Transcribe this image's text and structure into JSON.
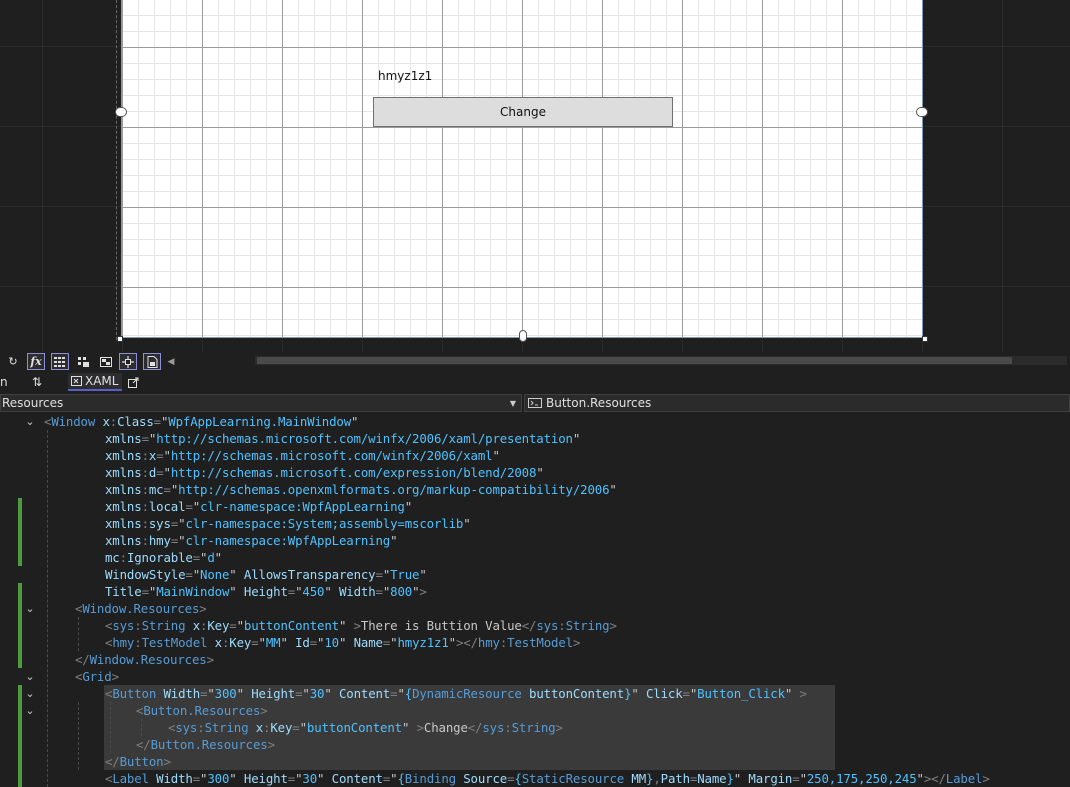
{
  "designer": {
    "label_text": "hmyz1z1",
    "button_text": "Change"
  },
  "toolbar": {
    "refresh_icon": "refresh-icon",
    "formula_icon": "fx-icon",
    "fx_label": "fx",
    "grid_icon": "grid-icon",
    "snap_icon": "snap-to-grid-icon",
    "artboard_icon": "artboard-icon",
    "snaplines_icon": "snaplines-icon",
    "project_code_icon": "project-code-icon",
    "scroll_left_icon": "scroll-left-icon"
  },
  "split_tabs": {
    "design_stub": "n",
    "swap_icon": "swap-panes-icon",
    "xaml_tab": "XAML",
    "popout_icon": "popout-icon"
  },
  "nav": {
    "left_combo": "Resources",
    "right_combo": "Button.Resources"
  },
  "code_lines": [
    [
      [
        "p",
        "<"
      ],
      [
        "e",
        "Window"
      ],
      [
        "a",
        " x"
      ],
      [
        "p",
        ":"
      ],
      [
        "a",
        "Class"
      ],
      [
        "p",
        "="
      ],
      [
        "x",
        "\""
      ],
      [
        "v",
        "WpfAppLearning.MainWindow"
      ],
      [
        "x",
        "\""
      ]
    ],
    [
      [
        "a",
        "xmlns"
      ],
      [
        "p",
        "="
      ],
      [
        "x",
        "\""
      ],
      [
        "v",
        "http://schemas.microsoft.com/winfx/2006/xaml/presentation"
      ],
      [
        "x",
        "\""
      ]
    ],
    [
      [
        "a",
        "xmlns"
      ],
      [
        "p",
        ":"
      ],
      [
        "a",
        "x"
      ],
      [
        "p",
        "="
      ],
      [
        "x",
        "\""
      ],
      [
        "v",
        "http://schemas.microsoft.com/winfx/2006/xaml"
      ],
      [
        "x",
        "\""
      ]
    ],
    [
      [
        "a",
        "xmlns"
      ],
      [
        "p",
        ":"
      ],
      [
        "a",
        "d"
      ],
      [
        "p",
        "="
      ],
      [
        "x",
        "\""
      ],
      [
        "v",
        "http://schemas.microsoft.com/expression/blend/2008"
      ],
      [
        "x",
        "\""
      ]
    ],
    [
      [
        "a",
        "xmlns"
      ],
      [
        "p",
        ":"
      ],
      [
        "a",
        "mc"
      ],
      [
        "p",
        "="
      ],
      [
        "x",
        "\""
      ],
      [
        "v",
        "http://schemas.openxmlformats.org/markup-compatibility/2006"
      ],
      [
        "x",
        "\""
      ]
    ],
    [
      [
        "a",
        "xmlns"
      ],
      [
        "p",
        ":"
      ],
      [
        "a",
        "local"
      ],
      [
        "p",
        "="
      ],
      [
        "x",
        "\""
      ],
      [
        "v",
        "clr-namespace:WpfAppLearning"
      ],
      [
        "x",
        "\""
      ]
    ],
    [
      [
        "a",
        "xmlns"
      ],
      [
        "p",
        ":"
      ],
      [
        "a",
        "sys"
      ],
      [
        "p",
        "="
      ],
      [
        "x",
        "\""
      ],
      [
        "v",
        "clr-namespace:System;assembly=mscorlib"
      ],
      [
        "x",
        "\""
      ]
    ],
    [
      [
        "a",
        "xmlns"
      ],
      [
        "p",
        ":"
      ],
      [
        "a",
        "hmy"
      ],
      [
        "p",
        "="
      ],
      [
        "x",
        "\""
      ],
      [
        "v",
        "clr-namespace:WpfAppLearning"
      ],
      [
        "x",
        "\""
      ]
    ],
    [
      [
        "a",
        "mc"
      ],
      [
        "p",
        ":"
      ],
      [
        "a",
        "Ignorable"
      ],
      [
        "p",
        "="
      ],
      [
        "x",
        "\""
      ],
      [
        "v",
        "d"
      ],
      [
        "x",
        "\""
      ]
    ],
    [
      [
        "a",
        "WindowStyle"
      ],
      [
        "p",
        "="
      ],
      [
        "x",
        "\""
      ],
      [
        "v",
        "None"
      ],
      [
        "x",
        "\""
      ],
      [
        "a",
        " AllowsTransparency"
      ],
      [
        "p",
        "="
      ],
      [
        "x",
        "\""
      ],
      [
        "v",
        "True"
      ],
      [
        "x",
        "\""
      ]
    ],
    [
      [
        "a",
        "Title"
      ],
      [
        "p",
        "="
      ],
      [
        "x",
        "\""
      ],
      [
        "v",
        "MainWindow"
      ],
      [
        "x",
        "\""
      ],
      [
        "a",
        " Height"
      ],
      [
        "p",
        "="
      ],
      [
        "x",
        "\""
      ],
      [
        "v",
        "450"
      ],
      [
        "x",
        "\""
      ],
      [
        "a",
        " Width"
      ],
      [
        "p",
        "="
      ],
      [
        "x",
        "\""
      ],
      [
        "v",
        "800"
      ],
      [
        "x",
        "\""
      ],
      [
        "p",
        ">"
      ]
    ],
    [
      [
        "p",
        "<"
      ],
      [
        "e",
        "Window.Resources"
      ],
      [
        "p",
        ">"
      ]
    ],
    [
      [
        "p",
        "<"
      ],
      [
        "e",
        "sys"
      ],
      [
        "p",
        ":"
      ],
      [
        "e",
        "String"
      ],
      [
        "a",
        " x"
      ],
      [
        "p",
        ":"
      ],
      [
        "a",
        "Key"
      ],
      [
        "p",
        "="
      ],
      [
        "x",
        "\""
      ],
      [
        "v",
        "buttonContent"
      ],
      [
        "x",
        "\""
      ],
      [
        "p",
        " >"
      ],
      [
        "x",
        "There is Buttion Value"
      ],
      [
        "p",
        "</"
      ],
      [
        "e",
        "sys"
      ],
      [
        "p",
        ":"
      ],
      [
        "e",
        "String"
      ],
      [
        "p",
        ">"
      ]
    ],
    [
      [
        "p",
        "<"
      ],
      [
        "e",
        "hmy"
      ],
      [
        "p",
        ":"
      ],
      [
        "e",
        "TestModel"
      ],
      [
        "a",
        " x"
      ],
      [
        "p",
        ":"
      ],
      [
        "a",
        "Key"
      ],
      [
        "p",
        "="
      ],
      [
        "x",
        "\""
      ],
      [
        "v",
        "MM"
      ],
      [
        "x",
        "\""
      ],
      [
        "a",
        " Id"
      ],
      [
        "p",
        "="
      ],
      [
        "x",
        "\""
      ],
      [
        "v",
        "10"
      ],
      [
        "x",
        "\""
      ],
      [
        "a",
        " Name"
      ],
      [
        "p",
        "="
      ],
      [
        "x",
        "\""
      ],
      [
        "v",
        "hmyz1z1"
      ],
      [
        "x",
        "\""
      ],
      [
        "p",
        "></"
      ],
      [
        "e",
        "hmy"
      ],
      [
        "p",
        ":"
      ],
      [
        "e",
        "TestModel"
      ],
      [
        "p",
        ">"
      ]
    ],
    [
      [
        "p",
        "</"
      ],
      [
        "e",
        "Window.Resources"
      ],
      [
        "p",
        ">"
      ]
    ],
    [
      [
        "p",
        "<"
      ],
      [
        "e",
        "Grid"
      ],
      [
        "p",
        ">"
      ]
    ],
    [
      [
        "p",
        "<"
      ],
      [
        "e",
        "Button"
      ],
      [
        "a",
        " Width"
      ],
      [
        "p",
        "="
      ],
      [
        "x",
        "\""
      ],
      [
        "v",
        "300"
      ],
      [
        "x",
        "\""
      ],
      [
        "a",
        " Height"
      ],
      [
        "p",
        "="
      ],
      [
        "x",
        "\""
      ],
      [
        "v",
        "30"
      ],
      [
        "x",
        "\""
      ],
      [
        "a",
        " Content"
      ],
      [
        "p",
        "="
      ],
      [
        "x",
        "\""
      ],
      [
        "v",
        "{"
      ],
      [
        "e",
        "DynamicResource"
      ],
      [
        "a",
        " buttonContent"
      ],
      [
        "v",
        "}"
      ],
      [
        "x",
        "\""
      ],
      [
        "a",
        " Click"
      ],
      [
        "p",
        "="
      ],
      [
        "x",
        "\""
      ],
      [
        "v",
        "Button_Click"
      ],
      [
        "x",
        "\""
      ],
      [
        "p",
        " >"
      ]
    ],
    [
      [
        "p",
        "<"
      ],
      [
        "e",
        "Button.Resources"
      ],
      [
        "p",
        ">"
      ]
    ],
    [
      [
        "p",
        "<"
      ],
      [
        "e",
        "sys"
      ],
      [
        "p",
        ":"
      ],
      [
        "e",
        "String"
      ],
      [
        "a",
        " x"
      ],
      [
        "p",
        ":"
      ],
      [
        "a",
        "Key"
      ],
      [
        "p",
        "="
      ],
      [
        "x",
        "\""
      ],
      [
        "v",
        "buttonContent"
      ],
      [
        "x",
        "\""
      ],
      [
        "p",
        " >"
      ],
      [
        "x",
        "Change"
      ],
      [
        "p",
        "</"
      ],
      [
        "e",
        "sys"
      ],
      [
        "p",
        ":"
      ],
      [
        "e",
        "String"
      ],
      [
        "p",
        ">"
      ]
    ],
    [
      [
        "p",
        "</"
      ],
      [
        "e",
        "Button.Resources"
      ],
      [
        "p",
        ">"
      ]
    ],
    [
      [
        "p",
        "</"
      ],
      [
        "e",
        "Button"
      ],
      [
        "p",
        ">"
      ]
    ],
    [
      [
        "p",
        "<"
      ],
      [
        "e",
        "Label"
      ],
      [
        "a",
        " Width"
      ],
      [
        "p",
        "="
      ],
      [
        "x",
        "\""
      ],
      [
        "v",
        "300"
      ],
      [
        "x",
        "\""
      ],
      [
        "a",
        " Height"
      ],
      [
        "p",
        "="
      ],
      [
        "x",
        "\""
      ],
      [
        "v",
        "30"
      ],
      [
        "x",
        "\""
      ],
      [
        "a",
        " Content"
      ],
      [
        "p",
        "="
      ],
      [
        "x",
        "\""
      ],
      [
        "v",
        "{"
      ],
      [
        "e",
        "Binding"
      ],
      [
        "a",
        " Source"
      ],
      [
        "p",
        "="
      ],
      [
        "v",
        "{"
      ],
      [
        "e",
        "StaticResource"
      ],
      [
        "a",
        " MM"
      ],
      [
        "v",
        "}"
      ],
      [
        "p",
        ","
      ],
      [
        "a",
        "Path"
      ],
      [
        "p",
        "="
      ],
      [
        "a",
        "Name"
      ],
      [
        "v",
        "}"
      ],
      [
        "x",
        "\""
      ],
      [
        "a",
        " Margin"
      ],
      [
        "p",
        "="
      ],
      [
        "x",
        "\""
      ],
      [
        "v",
        "250,175,250,245"
      ],
      [
        "x",
        "\""
      ],
      [
        "p",
        "></"
      ],
      [
        "e",
        "Label"
      ],
      [
        "p",
        ">"
      ]
    ]
  ]
}
